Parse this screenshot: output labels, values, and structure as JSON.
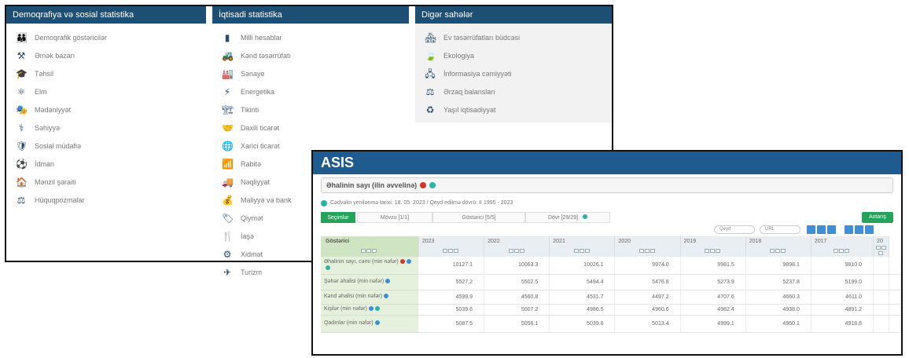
{
  "categories": [
    {
      "header": "Demoqrafiya və sosial statistika",
      "items": [
        {
          "label": "Demoqrafik göstəricilər",
          "icon": "family-icon"
        },
        {
          "label": "Əmək bazarı",
          "icon": "worker-icon"
        },
        {
          "label": "Təhsil",
          "icon": "graduation-cap-icon"
        },
        {
          "label": "Elm",
          "icon": "atom-icon"
        },
        {
          "label": "Mədəniyyət",
          "icon": "theatre-icon"
        },
        {
          "label": "Səhiyyə",
          "icon": "stethoscope-icon"
        },
        {
          "label": "Sosial müdafiə",
          "icon": "shield-hands-icon"
        },
        {
          "label": "İdman",
          "icon": "sport-icon"
        },
        {
          "label": "Mənzil şəraiti",
          "icon": "housing-icon"
        },
        {
          "label": "Hüquqpozmalar",
          "icon": "gavel-icon"
        }
      ]
    },
    {
      "header": "İqtisadi statistika",
      "items": [
        {
          "label": "Milli hesablar",
          "icon": "bar-chart-icon"
        },
        {
          "label": "Kənd təsərrüfatı",
          "icon": "tractor-icon"
        },
        {
          "label": "Sənaye",
          "icon": "factory-icon"
        },
        {
          "label": "Energetika",
          "icon": "energy-icon"
        },
        {
          "label": "Tikinti",
          "icon": "crane-icon"
        },
        {
          "label": "Daxili ticarət",
          "icon": "handshake-icon"
        },
        {
          "label": "Xarici ticarət",
          "icon": "globe-trade-icon"
        },
        {
          "label": "Rabitə",
          "icon": "signal-icon"
        },
        {
          "label": "Nəqliyyat",
          "icon": "truck-icon"
        },
        {
          "label": "Maliyyə və bank",
          "icon": "money-icon"
        },
        {
          "label": "Qiymət",
          "icon": "price-tag-icon"
        },
        {
          "label": "İaşə",
          "icon": "food-icon"
        },
        {
          "label": "Xidmət",
          "icon": "service-icon"
        },
        {
          "label": "Turizm",
          "icon": "airplane-icon"
        }
      ]
    },
    {
      "header": "Digər sahələr",
      "items": [
        {
          "label": "Ev təsərrüfatları büdcəsi",
          "icon": "household-budget-icon"
        },
        {
          "label": "Ekologiya",
          "icon": "leaf-icon"
        },
        {
          "label": "İnformasiya cəmiyyəti",
          "icon": "network-icon"
        },
        {
          "label": "Ərzaq balansları",
          "icon": "food-balance-icon"
        },
        {
          "label": "Yaşıl iqtisadiyyat",
          "icon": "green-economy-icon"
        }
      ]
    }
  ],
  "asis": {
    "brand": "ASIS",
    "indicator_title": "Əhalinin sayı (ilin əvvelinə)",
    "meta": "Cədvəlin yenilənmə tarixi: 18. 05. 2023 / Qeyd edilmə dövrü: II 1995 - 2023",
    "tabs": [
      "Seçimlər",
      "Mövzu [1/1]",
      "Göstərici [5/5]",
      "Dövr [29/29]"
    ],
    "search_button": "Axtarış",
    "dropdowns": [
      "Qeyd",
      "URL"
    ],
    "table": {
      "indicator_header": "Göstərici",
      "years": [
        "2023",
        "2022",
        "2021",
        "2020",
        "2019",
        "2018",
        "2017",
        "20"
      ],
      "rows": [
        {
          "label": "Əhalinin sayı, cəmi (min nəfər)",
          "values": [
            "10127.1",
            "10063.3",
            "10026.1",
            "9974.0",
            "9981.5",
            "9898.1",
            "9810.0",
            ""
          ]
        },
        {
          "label": "Şəhər əhalisi (min nəfər)",
          "values": [
            "5527.2",
            "5502.5",
            "5494.4",
            "5476.8",
            "5273.9",
            "5237.8",
            "5199.0",
            ""
          ]
        },
        {
          "label": "Kənd əhalisi (min nəfər)",
          "values": [
            "4599.9",
            "4560.8",
            "4531.7",
            "4497.2",
            "4707.6",
            "4660.3",
            "4611.0",
            ""
          ]
        },
        {
          "label": "Kişilər (min nəfər)",
          "values": [
            "5039.6",
            "5007.2",
            "4986.5",
            "4960.6",
            "4982.4",
            "4938.0",
            "4891.2",
            ""
          ]
        },
        {
          "label": "Qadınlar (min nəfər)",
          "values": [
            "5087.5",
            "5056.1",
            "5039.6",
            "5013.4",
            "4999.1",
            "4960.1",
            "4918.8",
            ""
          ]
        }
      ]
    }
  },
  "colors": {
    "header_blue": "#1d4e74",
    "asis_blue": "#1f5b8e",
    "green": "#26a35a",
    "indicator_bg": "#cfe4c2"
  }
}
